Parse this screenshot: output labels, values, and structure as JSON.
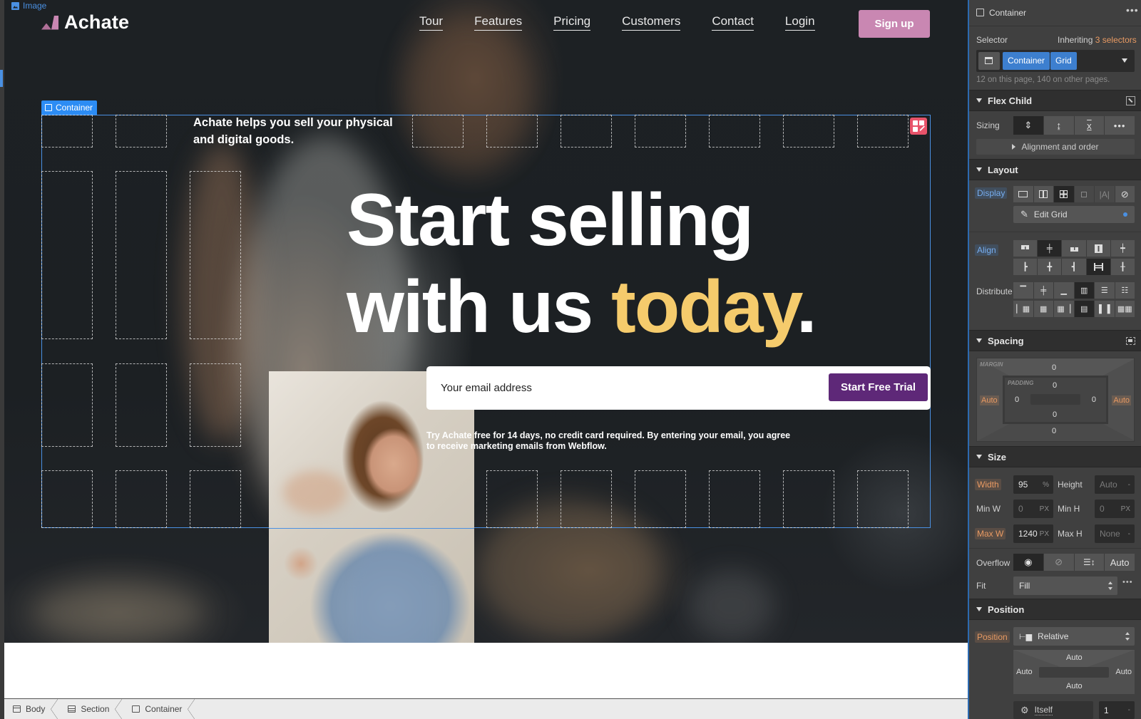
{
  "canvas": {
    "image_tag": "Image",
    "container_tag": "Container",
    "brand": {
      "name": "Achate",
      "accent": "#c987b2"
    },
    "nav": {
      "links": [
        "Tour",
        "Features",
        "Pricing",
        "Customers",
        "Contact",
        "Login"
      ],
      "signup_label": "Sign up"
    },
    "hero": {
      "tagline": "Achate helps you sell your physical and digital goods.",
      "headline_line1": "Start selling",
      "headline_line2_prefix": "with us ",
      "headline_accent": "today",
      "headline_suffix": ".",
      "accent_color": "#f5cb6c",
      "email_placeholder": "Your email address",
      "email_value": "",
      "cta_label": "Start Free Trial",
      "cta_color": "#5e2878",
      "legal": "Try Achate free for 14 days, no credit card required. By entering your email, you agree to receive marketing emails from Webflow."
    }
  },
  "breadcrumb": [
    {
      "label": "Body",
      "icon": "body-icon"
    },
    {
      "label": "Section",
      "icon": "section-icon"
    },
    {
      "label": "Container",
      "icon": "container-icon"
    }
  ],
  "panel": {
    "element_name": "Container",
    "more_icon": "more-icon",
    "selector": {
      "label": "Selector",
      "inheriting_prefix": "Inheriting",
      "inheriting_count": "3 selectors",
      "chips": [
        "Container",
        "Grid"
      ],
      "usage": "12 on this page, 140 on other pages."
    },
    "flex_child": {
      "title": "Flex Child",
      "sizing_label": "Sizing",
      "sizing_options": [
        "shrink",
        "grow",
        "none",
        "more"
      ],
      "sizing_selected": "shrink",
      "alignment_label": "Alignment and order"
    },
    "layout": {
      "title": "Layout",
      "display_label": "Display",
      "display_options": [
        "block",
        "flex",
        "grid",
        "inline-block",
        "inline",
        "none"
      ],
      "display_selected": "grid",
      "edit_grid_label": "Edit Grid",
      "align_label": "Align",
      "distribute_label": "Distribute"
    },
    "spacing": {
      "title": "Spacing",
      "margin_label": "MARGIN",
      "padding_label": "PADDING",
      "margin": {
        "top": "0",
        "right": "Auto",
        "bottom": "0",
        "left": "Auto"
      },
      "padding": {
        "top": "0",
        "right": "0",
        "bottom": "0",
        "left": "0"
      }
    },
    "size": {
      "title": "Size",
      "width_label": "Width",
      "width_value": "95",
      "width_unit": "%",
      "height_label": "Height",
      "height_value": "Auto",
      "height_unit": "-",
      "min_w_label": "Min W",
      "min_w_value": "0",
      "min_w_unit": "PX",
      "min_h_label": "Min H",
      "min_h_value": "0",
      "min_h_unit": "PX",
      "max_w_label": "Max W",
      "max_w_value": "1240",
      "max_w_unit": "PX",
      "max_h_label": "Max H",
      "max_h_value": "None",
      "max_h_unit": "-",
      "overflow_label": "Overflow",
      "overflow_auto": "Auto",
      "fit_label": "Fit",
      "fit_value": "Fill"
    },
    "position": {
      "title": "Position",
      "position_label": "Position",
      "position_value": "Relative",
      "offsets": {
        "top": "Auto",
        "right": "Auto",
        "bottom": "Auto",
        "left": "Auto"
      },
      "relative_to": "Itself",
      "z_index": "1",
      "z_unit": "-"
    }
  }
}
